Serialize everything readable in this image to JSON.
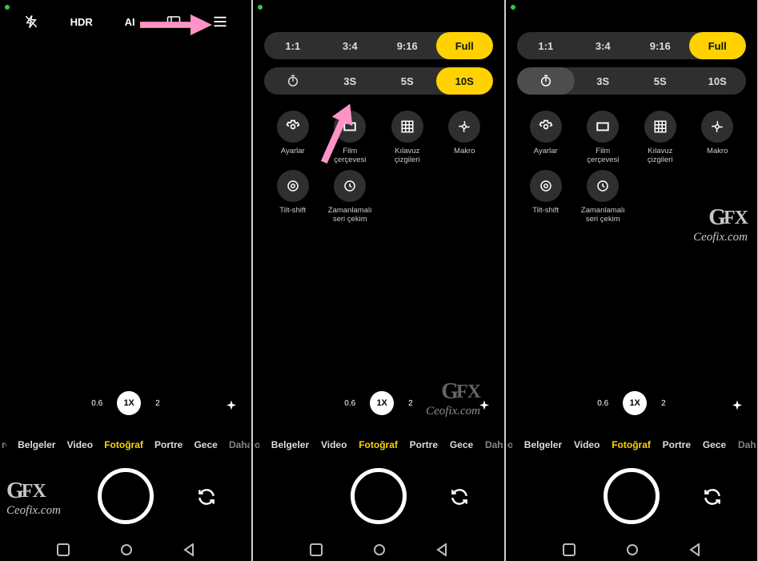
{
  "topBar": {
    "hdr": "HDR",
    "ai": "AI"
  },
  "aspect": {
    "o1": "1:1",
    "o2": "3:4",
    "o3": "9:16",
    "o4": "Full"
  },
  "timer": {
    "o1": "3S",
    "o2": "5S",
    "o3": "10S"
  },
  "icons": {
    "ayarlar": "Ayarlar",
    "film": "Film\nçerçevesi",
    "kilavuz": "Kılavuz\nçizgileri",
    "makro": "Makro",
    "tilt": "Tilt-shift",
    "seri": "Zamanlamalı\nseri çekim"
  },
  "zoom": {
    "z06": "0.6",
    "z1": "1X",
    "z2": "2"
  },
  "modes": {
    "belgeler": "Belgeler",
    "video": "Video",
    "foto": "Fotoğraf",
    "portre": "Portre",
    "gece": "Gece",
    "daha": "Daha"
  },
  "watermark": {
    "brand": "Ceofix.com"
  },
  "edge": {
    "left": "ro",
    "right": "o"
  }
}
